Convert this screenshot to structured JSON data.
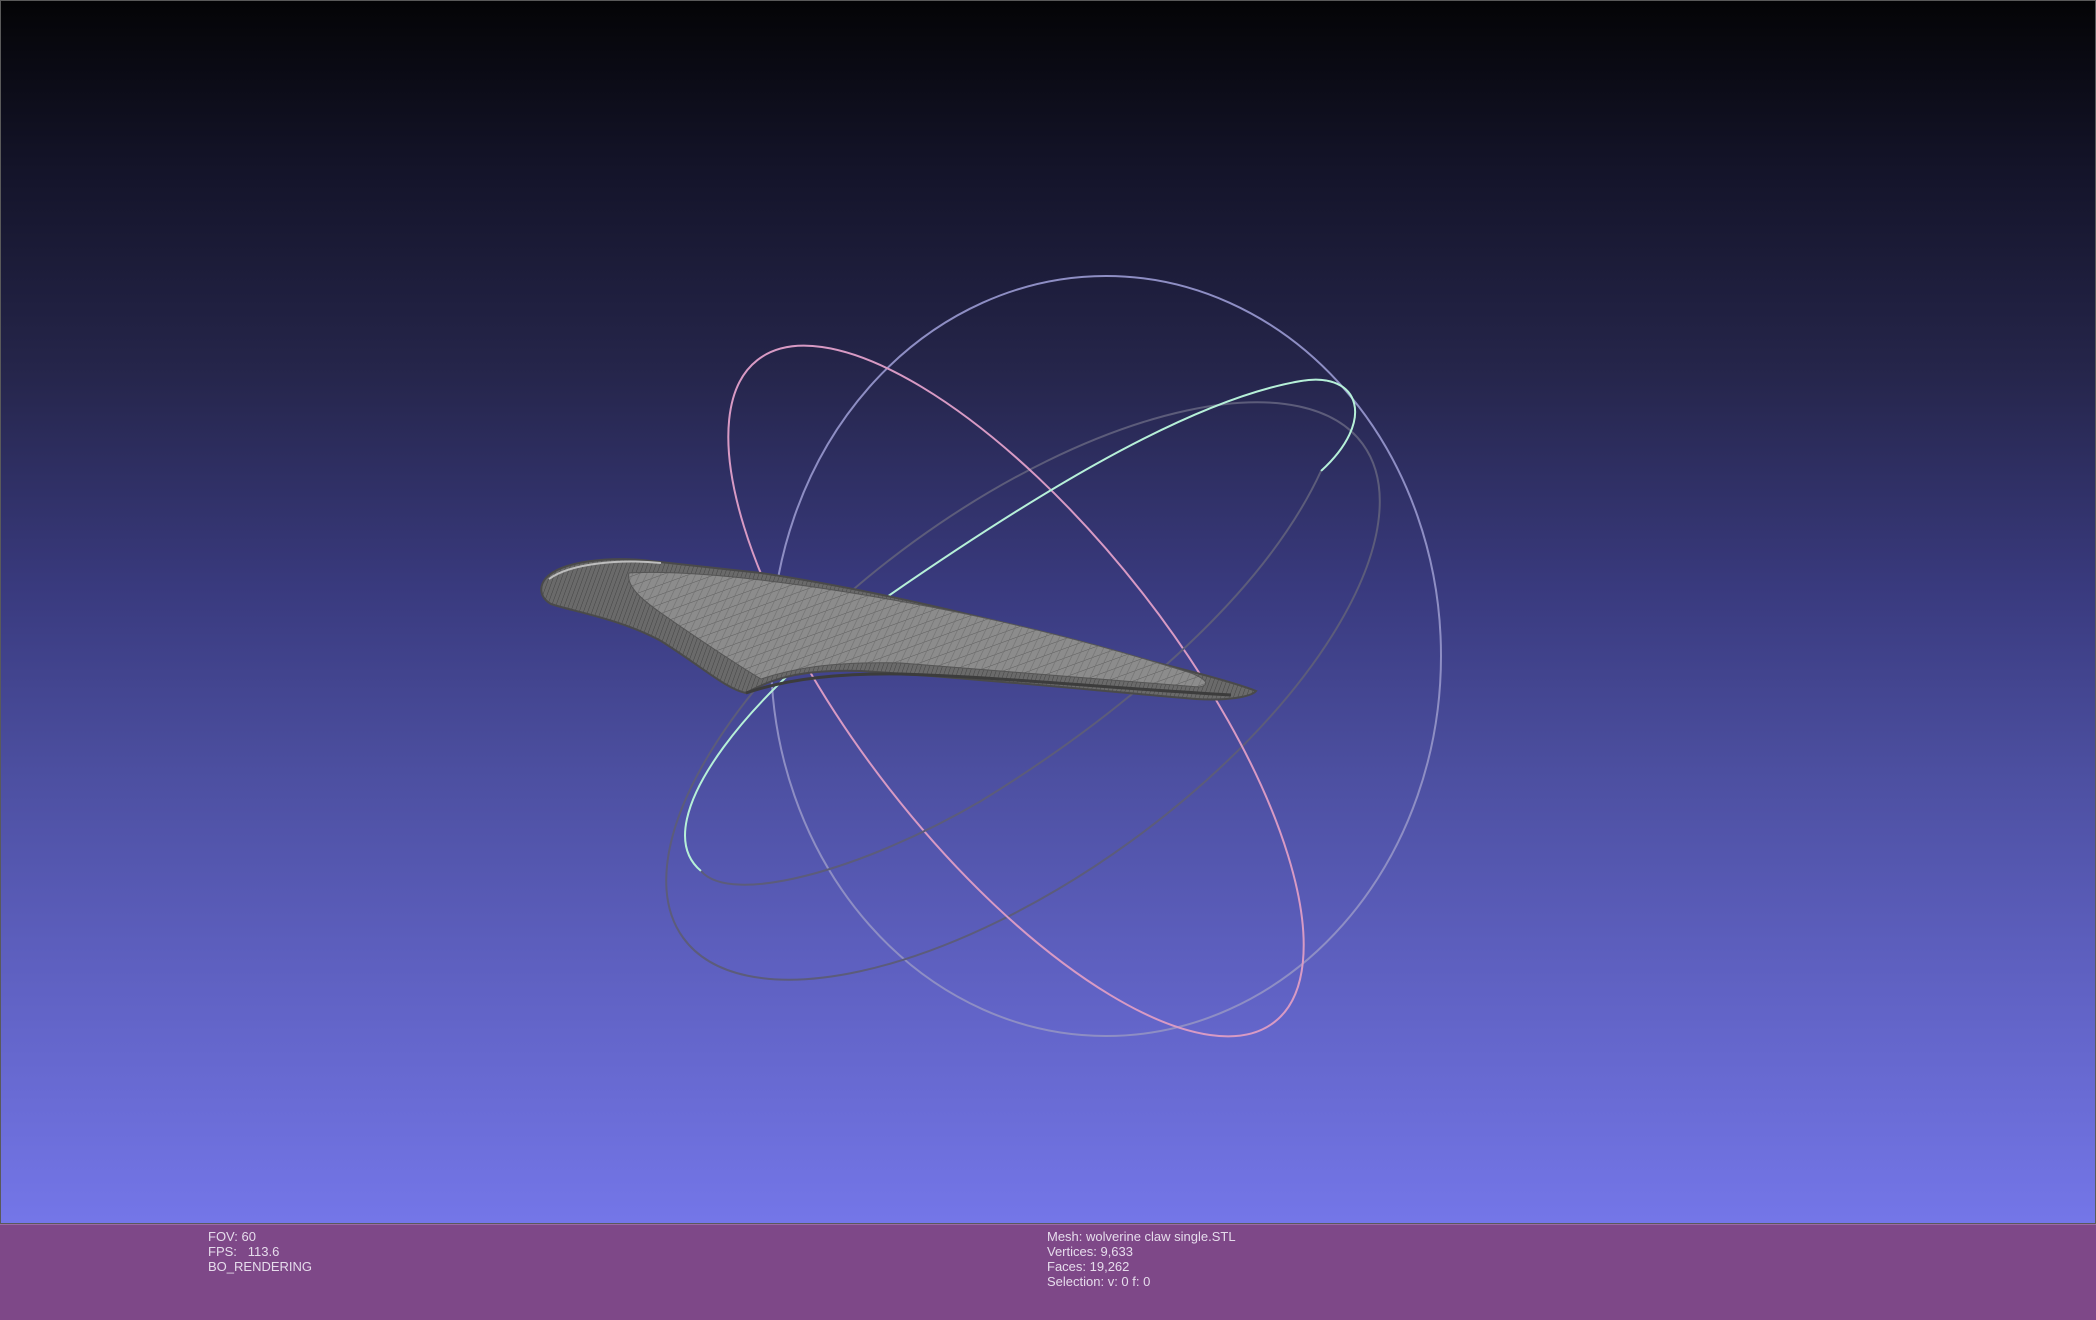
{
  "viewport": {
    "background_top": "#040406",
    "background_bottom": "#7476e8",
    "mesh_color": "#8a8a8a",
    "trackball": {
      "red_ring_color": "#e8a0c0",
      "green_ring_color": "#b0f0d8",
      "blue_ring_color": "#b8b8e8"
    }
  },
  "info_left": {
    "fov": "FOV: 60",
    "fps": "FPS:   113.6",
    "mode": "BO_RENDERING"
  },
  "info_right": {
    "mesh": "Mesh: wolverine claw single.STL",
    "vertices": "Vertices: 9,633",
    "faces": "Faces: 19,262",
    "selection": "Selection: v: 0 f: 0"
  },
  "info_bar_color": "#7e4888"
}
